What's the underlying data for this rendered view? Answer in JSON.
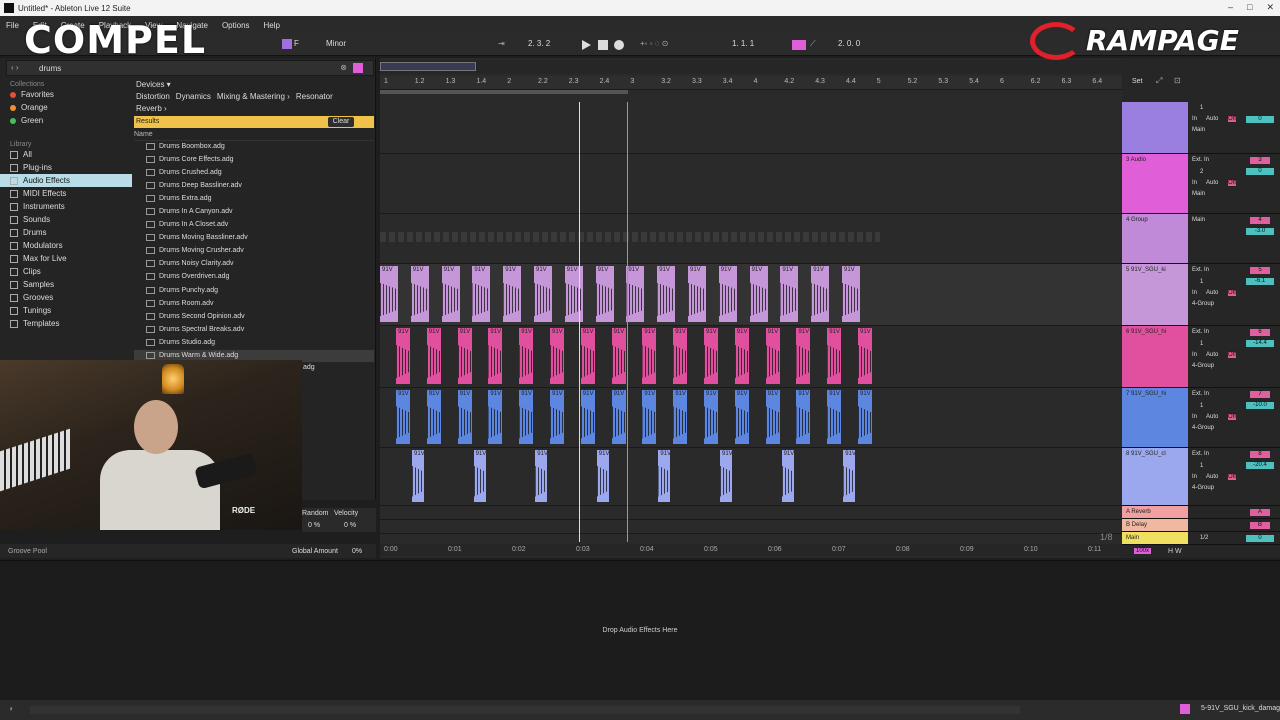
{
  "window": {
    "title": "Untitled* - Ableton Live 12 Suite"
  },
  "menu": [
    "File",
    "Edit",
    "Create",
    "Playback",
    "View",
    "Navigate",
    "Options",
    "Help"
  ],
  "transport": {
    "key": "F",
    "scale": "Minor",
    "position": "2. 3. 2",
    "loop_start": "1. 1. 1",
    "loop_length": "2. 0. 0"
  },
  "browser": {
    "search": "drums",
    "collections_head": "Collections",
    "collections": [
      {
        "label": "Favorites",
        "color": "#e0503a"
      },
      {
        "label": "Orange",
        "color": "#f09030"
      },
      {
        "label": "Green",
        "color": "#40c060"
      }
    ],
    "library_head": "Library",
    "library": [
      "All",
      "Plug-ins",
      "Audio Effects",
      "MIDI Effects",
      "Instruments",
      "Sounds",
      "Drums",
      "Modulators",
      "Max for Live",
      "Clips",
      "Samples",
      "Grooves",
      "Tunings",
      "Templates"
    ],
    "filter_root": "Devices ▾",
    "filters_row1": [
      "Distortion",
      "Dynamics",
      "Mixing & Mastering ›",
      "Resonator"
    ],
    "filters_row2": [
      "Reverb ›"
    ],
    "results_label": "Results",
    "clear_label": "Clear",
    "name_header": "Name",
    "files": [
      "Drums Boombox.adg",
      "Drums Core Effects.adg",
      "Drums Crushed.adg",
      "Drums Deep Bassliner.adv",
      "Drums Extra.adg",
      "Drums In A Canyon.adv",
      "Drums In A Closet.adv",
      "Drums Moving Bassliner.adv",
      "Drums Moving Crusher.adv",
      "Drums Noisy Clarity.adv",
      "Drums Overdriven.adg",
      "Drums Punchy.adg",
      "Drums Room.adv",
      "Drums Second Opinion.adv",
      "Drums Spectral Breaks.adv",
      "Drums Studio.adg",
      "Drums Warm & Wide.adg"
    ],
    "partial_file": "adg",
    "groove_random": "Random",
    "groove_velocity": "Velocity",
    "groove_pct1": "0 %",
    "groove_pct2": "0 %",
    "groove_pool": "Groove Pool",
    "global_amount": "Global Amount",
    "global_amount_val": "0%"
  },
  "ruler": [
    "1",
    "1.2",
    "1.3",
    "1.4",
    "2",
    "2.2",
    "2.3",
    "2.4",
    "3",
    "3.2",
    "3.3",
    "3.4",
    "4",
    "4.2",
    "4.3",
    "4.4",
    "5",
    "5.2",
    "5.3",
    "5.4",
    "6",
    "6.2",
    "6.3",
    "6.4"
  ],
  "timeline": [
    "0:00",
    "0:01",
    "0:02",
    "0:03",
    "0:04",
    "0:05",
    "0:06",
    "0:07",
    "0:08",
    "0:09",
    "0:10",
    "0:11"
  ],
  "clip_label": "91V",
  "mixer": {
    "set_label": "Set",
    "tracks": [
      {
        "name": "",
        "color": "#9a7fe0",
        "input": "",
        "ch": "1",
        "route": "Main",
        "num": "",
        "vol": "0"
      },
      {
        "name": "3 Audio",
        "color": "#e05fd8",
        "input": "Ext. In",
        "ch": "2",
        "route": "Main",
        "num": "3",
        "vol": "0"
      },
      {
        "name": "4 Group",
        "color": "#c08ad8",
        "input": "",
        "ch": "",
        "route": "Main",
        "num": "4",
        "vol": "-3.0"
      },
      {
        "name": "5 91V_SGU_ki",
        "color": "#c596d8",
        "input": "Ext. In",
        "ch": "1",
        "route": "4-Group",
        "num": "5",
        "vol": "-6.1"
      },
      {
        "name": "6 91V_SGU_hi",
        "color": "#e0509e",
        "input": "Ext. In",
        "ch": "1",
        "route": "4-Group",
        "num": "6",
        "vol": "-14.4"
      },
      {
        "name": "7 91V_SGU_hi",
        "color": "#5c86e0",
        "input": "Ext. In",
        "ch": "1",
        "route": "4-Group",
        "num": "7",
        "vol": "-10.0"
      },
      {
        "name": "8 91V_SGU_cl",
        "color": "#9ca8ee",
        "input": "Ext. In",
        "ch": "1",
        "route": "4-Group",
        "num": "8",
        "vol": "-20.4"
      }
    ],
    "returns": [
      {
        "name": "A Reverb",
        "color": "#f0a0a0",
        "num": "A"
      },
      {
        "name": "B Delay",
        "color": "#f0b8a0",
        "num": "B"
      }
    ],
    "main": {
      "name": "Main",
      "color": "#f0e060",
      "route": "1/2",
      "vol": "0"
    },
    "quantize": "1/8",
    "master_zoom": "100x",
    "auto_label": "Auto",
    "off_label": "Off",
    "in_label": "In"
  },
  "device_area": {
    "drop_msg": "Drop Audio Effects Here"
  },
  "status": {
    "selected_clip": "5-91V_SGU_kick_damag"
  },
  "overlays": {
    "left_logo": "COMPEL",
    "right_logo": "RAMPAGE",
    "mic_brand": "RØDE"
  }
}
